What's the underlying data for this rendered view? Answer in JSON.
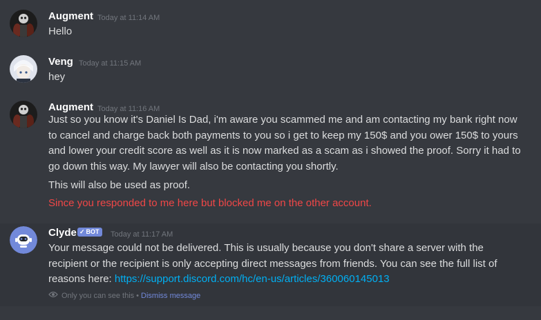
{
  "messages": [
    {
      "author": "Augment",
      "timestamp": "Today at 11:14 AM",
      "lines": [
        "Hello"
      ]
    },
    {
      "author": "Veng",
      "timestamp": "Today at 11:15 AM",
      "lines": [
        "hey"
      ]
    },
    {
      "author": "Augment",
      "timestamp": "Today at 11:16 AM",
      "lines": [
        "Just so you know it's Daniel Is Dad, i'm aware you scammed me and am contacting my bank right now to cancel and charge back both payments to you so i get to keep my 150$ and you ower 150$ to yours and lower your credit score as well as it is now marked as a scam as i showed the proof. Sorry it had to go down this way. My lawyer will also be contacting you shortly.",
        "This will also be used as proof.",
        "Since you responded to me here but blocked me on the other account."
      ]
    }
  ],
  "clyde": {
    "author": "Clyde",
    "bot_tag": "BOT",
    "check_icon": "checkmark-icon",
    "timestamp": "Today at 11:17 AM",
    "text": "Your message could not be delivered. This is usually because you don't share a server with the recipient or the recipient is only accepting direct messages from friends. You can see the full list of reasons here: ",
    "link": "https://support.discord.com/hc/en-us/articles/360060145013",
    "only_you": "Only you can see this",
    "separator": "•",
    "dismiss": "Dismiss message"
  },
  "colors": {
    "background": "#36393f",
    "highlight": "#32353b",
    "username": "#ffffff",
    "text": "#dcddde",
    "timestamp": "#72767d",
    "red_text": "#f04747",
    "link": "#00b0f4",
    "blurple": "#7289da"
  }
}
